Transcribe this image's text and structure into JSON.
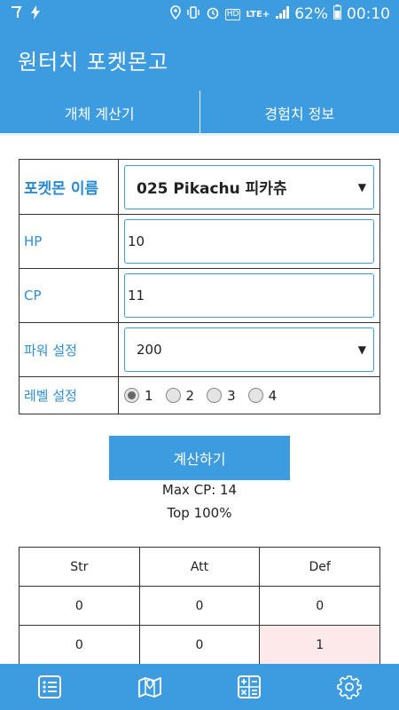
{
  "status_bar": {
    "battery": "62%",
    "time": "00:10",
    "network": "LTE+",
    "hd": "HD"
  },
  "app": {
    "title": "원터치 포켓몬고"
  },
  "tabs": [
    {
      "label": "개체 계산기"
    },
    {
      "label": "경험치 정보"
    }
  ],
  "form": {
    "pokemon_label": "포켓몬 이름",
    "pokemon_value": "025 Pikachu 피카츄",
    "hp_label": "HP",
    "hp_value": "10",
    "cp_label": "CP",
    "cp_value": "11",
    "power_label": "파워 설정",
    "power_value": "200",
    "level_label": "레벨 설정",
    "level_options": [
      "1",
      "2",
      "3",
      "4"
    ],
    "level_selected": "1"
  },
  "calculate_button": "계산하기",
  "results": {
    "max_cp": "Max CP: 14",
    "top": "Top 100%"
  },
  "stats_table": {
    "headers": [
      "Str",
      "Att",
      "Def"
    ],
    "rows": [
      [
        "0",
        "0",
        "0"
      ],
      [
        "0",
        "0",
        "1"
      ]
    ]
  },
  "bottom_nav": {
    "icons": [
      "list-icon",
      "map-icon",
      "calculator-icon",
      "settings-icon"
    ]
  },
  "colors": {
    "primary": "#3d9be0",
    "label": "#2f8fd4",
    "highlight": "#fde9e9"
  }
}
